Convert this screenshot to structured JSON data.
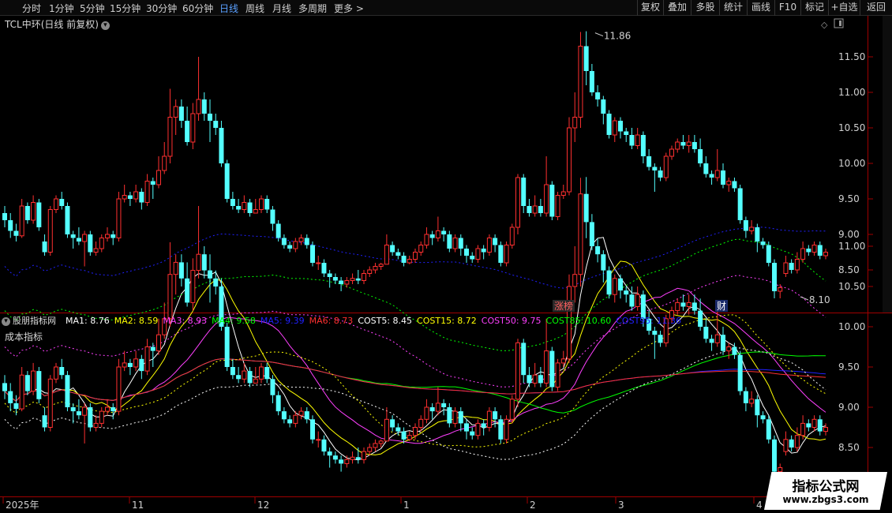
{
  "toolbar": {
    "tabs": [
      "分时",
      "1分钟",
      "5分钟",
      "15分钟",
      "30分钟",
      "60分钟",
      "日线",
      "周线",
      "月线",
      "多周期",
      "更多 >"
    ],
    "active_tab": "日线",
    "right_buttons": [
      "复权",
      "叠加",
      "多股",
      "统计",
      "画线",
      "F10",
      "标记",
      "+自选",
      "返回"
    ]
  },
  "stock": {
    "title": "TCL中环(日线 前复权)",
    "high_label": "11.86",
    "low_label": "8.10",
    "event_zhangbang": "涨榜",
    "event_cai": "财"
  },
  "colors": {
    "up": "#ff3030",
    "down": "#54ffff",
    "ma1": "#ffffff",
    "ma2": "#ffff00",
    "ma3": "#ff40ff",
    "ma4": "#00ff00",
    "ma5": "#2020ff",
    "ma6": "#ff3030",
    "cost5": "#ffffff",
    "cost15": "#ffff00",
    "cost50": "#ff40ff",
    "cost85": "#00ff00",
    "cost95": "#2020ff"
  },
  "price_axis": {
    "ticks": [
      "11.50",
      "11.00",
      "10.50",
      "10.00",
      "9.50",
      "9.00",
      "8.50"
    ]
  },
  "indicator": {
    "name": "股朋指标网",
    "subtitle": "成本指标",
    "items": [
      {
        "key": "ma1",
        "text": "MA1: 8.76"
      },
      {
        "key": "ma2",
        "text": "MA2: 8.59"
      },
      {
        "key": "ma3",
        "text": "MA3: 8.93"
      },
      {
        "key": "ma4",
        "text": "MA4: 9.58"
      },
      {
        "key": "ma5",
        "text": "MA5: 9.39"
      },
      {
        "key": "ma6",
        "text": "MA6: 8.73"
      },
      {
        "key": "cost5",
        "text": "COST5: 8.45"
      },
      {
        "key": "cost15",
        "text": "COST15: 8.72"
      },
      {
        "key": "cost50",
        "text": "COST50: 9.75"
      },
      {
        "key": "cost85",
        "text": "COST85: 10.60"
      },
      {
        "key": "cost95",
        "text": "COST95: 11.36"
      }
    ],
    "ticks": [
      "11.00",
      "10.50",
      "10.00",
      "9.50",
      "9.00",
      "8.50"
    ]
  },
  "date_axis": {
    "labels": [
      "2025年",
      "11",
      "12",
      "1",
      "2",
      "3",
      "4"
    ]
  },
  "watermark": {
    "line1": "指标公式网",
    "line2": "www.zbgs3.com"
  },
  "chart_data": {
    "type": "candlestick",
    "title": "TCL中环(日线 前复权)",
    "y_axis_ticks": [
      8.5,
      9.0,
      9.5,
      10.0,
      10.5,
      11.0,
      11.5
    ],
    "ylim": [
      8.0,
      12.0
    ],
    "x_axis_labels": [
      "2025年",
      "11",
      "12",
      "1",
      "2",
      "3",
      "4"
    ],
    "annotations": [
      {
        "text": "11.86",
        "kind": "high"
      },
      {
        "text": "8.10",
        "kind": "low"
      }
    ],
    "candles": [
      [
        9.3,
        9.2,
        9.4,
        9.1
      ],
      [
        9.2,
        9.05,
        9.3,
        8.95
      ],
      [
        9.05,
        8.98,
        9.15,
        8.9
      ],
      [
        8.98,
        9.4,
        9.5,
        8.95
      ],
      [
        9.4,
        9.2,
        9.45,
        9.15
      ],
      [
        9.2,
        9.45,
        9.55,
        9.15
      ],
      [
        9.45,
        9.1,
        9.5,
        9.05
      ],
      [
        8.9,
        8.75,
        9.0,
        8.7
      ],
      [
        8.75,
        9.35,
        9.4,
        8.7
      ],
      [
        9.35,
        9.5,
        9.55,
        9.3
      ],
      [
        9.5,
        9.4,
        9.6,
        9.35
      ],
      [
        9.4,
        9.0,
        9.45,
        8.95
      ],
      [
        9.0,
        8.95,
        9.05,
        8.8
      ],
      [
        8.95,
        8.9,
        9.1,
        8.85
      ],
      [
        8.9,
        9.0,
        9.05,
        8.55
      ],
      [
        9.0,
        8.75,
        9.05,
        8.7
      ],
      [
        8.75,
        8.8,
        8.9,
        8.7
      ],
      [
        8.8,
        8.95,
        9.0,
        8.75
      ],
      [
        8.95,
        9.0,
        9.1,
        8.9
      ],
      [
        9.0,
        8.95,
        9.05,
        8.85
      ],
      [
        8.95,
        9.5,
        9.6,
        8.9
      ],
      [
        9.5,
        9.55,
        9.7,
        9.45
      ],
      [
        9.55,
        9.5,
        9.6,
        9.4
      ],
      [
        9.5,
        9.6,
        9.7,
        9.45
      ],
      [
        9.6,
        9.45,
        9.65,
        9.35
      ],
      [
        9.45,
        9.75,
        9.85,
        9.4
      ],
      [
        9.75,
        9.7,
        9.8,
        9.5
      ],
      [
        9.7,
        9.9,
        10.1,
        9.65
      ],
      [
        9.9,
        10.1,
        10.3,
        9.85
      ],
      [
        10.1,
        10.65,
        11.05,
        10.0
      ],
      [
        10.65,
        10.8,
        10.9,
        10.4
      ],
      [
        10.8,
        10.6,
        10.9,
        10.5
      ],
      [
        10.6,
        10.3,
        10.8,
        10.25
      ],
      [
        10.3,
        10.7,
        10.85,
        10.2
      ],
      [
        10.7,
        10.9,
        11.5,
        10.6
      ],
      [
        10.9,
        10.7,
        11.0,
        10.6
      ],
      [
        10.7,
        10.6,
        10.9,
        10.3
      ],
      [
        10.6,
        10.5,
        10.7,
        10.4
      ],
      [
        10.5,
        10.0,
        10.6,
        9.95
      ],
      [
        10.0,
        9.5,
        10.05,
        9.45
      ],
      [
        9.5,
        9.4,
        9.6,
        9.35
      ],
      [
        9.4,
        9.35,
        9.5,
        9.3
      ],
      [
        9.35,
        9.45,
        9.55,
        9.3
      ],
      [
        9.45,
        9.3,
        9.5,
        9.25
      ],
      [
        9.3,
        9.35,
        9.5,
        9.3
      ],
      [
        9.35,
        9.5,
        9.55,
        9.3
      ],
      [
        9.5,
        9.35,
        9.55,
        9.3
      ],
      [
        9.35,
        9.15,
        9.4,
        9.05
      ],
      [
        9.15,
        8.95,
        9.2,
        8.9
      ],
      [
        8.95,
        8.85,
        9.0,
        8.8
      ],
      [
        8.85,
        8.8,
        8.9,
        8.75
      ],
      [
        8.8,
        8.9,
        8.95,
        8.75
      ],
      [
        8.9,
        8.95,
        9.0,
        8.85
      ],
      [
        8.95,
        8.85,
        9.0,
        8.8
      ],
      [
        8.85,
        8.6,
        8.9,
        8.55
      ],
      [
        8.6,
        8.6,
        8.7,
        8.5
      ],
      [
        8.6,
        8.45,
        8.65,
        8.4
      ],
      [
        8.45,
        8.4,
        8.5,
        8.25
      ],
      [
        8.4,
        8.35,
        8.45,
        8.3
      ],
      [
        8.35,
        8.3,
        8.4,
        8.2
      ],
      [
        8.3,
        8.35,
        8.4,
        8.25
      ],
      [
        8.35,
        8.38,
        8.45,
        8.3
      ],
      [
        8.38,
        8.35,
        8.5,
        8.3
      ],
      [
        8.35,
        8.45,
        8.5,
        8.3
      ],
      [
        8.45,
        8.5,
        8.55,
        8.4
      ],
      [
        8.5,
        8.55,
        8.6,
        8.45
      ],
      [
        8.55,
        8.58,
        8.6,
        8.5
      ],
      [
        8.58,
        8.85,
        9.0,
        8.75
      ],
      [
        8.85,
        8.75,
        8.9,
        8.7
      ],
      [
        8.75,
        8.7,
        8.8,
        8.65
      ],
      [
        8.7,
        8.6,
        8.75,
        8.55
      ],
      [
        8.6,
        8.65,
        8.7,
        8.58
      ],
      [
        8.65,
        8.75,
        8.8,
        8.6
      ],
      [
        8.75,
        8.85,
        8.9,
        8.7
      ],
      [
        8.85,
        9.0,
        9.1,
        8.8
      ],
      [
        9.0,
        8.95,
        9.05,
        8.85
      ],
      [
        8.95,
        9.05,
        9.25,
        8.9
      ],
      [
        9.05,
        9.0,
        9.1,
        8.9
      ],
      [
        9.0,
        8.8,
        9.05,
        8.75
      ],
      [
        8.8,
        8.95,
        9.0,
        8.75
      ],
      [
        8.95,
        8.8,
        9.0,
        8.7
      ],
      [
        8.8,
        8.7,
        8.85,
        8.6
      ],
      [
        8.7,
        8.65,
        8.75,
        8.6
      ],
      [
        8.65,
        8.8,
        8.85,
        8.6
      ],
      [
        8.8,
        8.75,
        8.85,
        8.65
      ],
      [
        8.75,
        8.95,
        9.0,
        8.7
      ],
      [
        8.95,
        8.85,
        9.0,
        8.75
      ],
      [
        8.85,
        8.6,
        8.9,
        8.55
      ],
      [
        8.6,
        8.85,
        8.9,
        8.55
      ],
      [
        8.85,
        9.1,
        9.15,
        8.8
      ],
      [
        9.1,
        9.8,
        9.85,
        9.0
      ],
      [
        9.8,
        9.4,
        9.85,
        9.3
      ],
      [
        9.4,
        9.3,
        9.5,
        9.25
      ],
      [
        9.3,
        9.4,
        9.55,
        9.25
      ],
      [
        9.4,
        9.3,
        9.5,
        9.25
      ],
      [
        9.3,
        9.7,
        10.1,
        9.25
      ],
      [
        9.7,
        9.25,
        9.75,
        9.2
      ],
      [
        9.25,
        9.55,
        9.6,
        9.2
      ],
      [
        9.55,
        9.6,
        9.7,
        9.5
      ],
      [
        9.6,
        10.5,
        10.65,
        9.55
      ],
      [
        10.5,
        10.65,
        11.0,
        10.3
      ],
      [
        10.65,
        11.65,
        11.85,
        10.5
      ],
      [
        11.65,
        11.3,
        11.86,
        11.1
      ],
      [
        11.3,
        11.0,
        11.4,
        10.95
      ],
      [
        11.0,
        10.9,
        11.1,
        10.8
      ],
      [
        10.9,
        10.7,
        10.95,
        10.55
      ],
      [
        10.7,
        10.4,
        10.75,
        10.35
      ],
      [
        10.4,
        10.6,
        10.65,
        10.3
      ],
      [
        10.6,
        10.45,
        10.65,
        10.35
      ],
      [
        10.45,
        10.4,
        10.5,
        10.3
      ],
      [
        10.4,
        10.25,
        10.5,
        10.2
      ],
      [
        10.25,
        10.4,
        10.5,
        10.2
      ],
      [
        10.4,
        10.1,
        10.45,
        10.0
      ],
      [
        10.1,
        9.95,
        10.2,
        9.9
      ],
      [
        9.95,
        9.9,
        10.0,
        9.6
      ],
      [
        9.9,
        9.8,
        9.95,
        9.75
      ],
      [
        9.8,
        10.1,
        10.15,
        9.75
      ],
      [
        10.1,
        10.2,
        10.25,
        10.05
      ],
      [
        10.2,
        10.3,
        10.35,
        10.15
      ],
      [
        10.3,
        10.25,
        10.4,
        10.2
      ],
      [
        10.25,
        10.3,
        10.4,
        10.15
      ],
      [
        10.3,
        10.2,
        10.4,
        10.15
      ],
      [
        10.2,
        10.0,
        10.35,
        9.95
      ],
      [
        10.0,
        9.85,
        10.1,
        9.8
      ],
      [
        9.85,
        9.8,
        9.9,
        9.7
      ],
      [
        9.8,
        9.9,
        10.2,
        9.75
      ],
      [
        9.9,
        9.7,
        10.0,
        9.65
      ],
      [
        9.7,
        9.75,
        9.8,
        9.6
      ],
      [
        9.75,
        9.65,
        9.8,
        9.6
      ],
      [
        9.65,
        9.2,
        9.7,
        9.15
      ],
      [
        9.2,
        9.05,
        9.25,
        8.95
      ],
      [
        9.05,
        9.1,
        9.2,
        9.0
      ],
      [
        9.1,
        8.9,
        9.15,
        8.75
      ],
      [
        8.9,
        8.85,
        8.95,
        8.8
      ],
      [
        8.85,
        8.6,
        8.9,
        8.55
      ],
      [
        8.6,
        8.2,
        8.65,
        8.1
      ],
      [
        8.2,
        8.25,
        8.3,
        8.1
      ],
      [
        8.45,
        8.6,
        8.7,
        8.4
      ],
      [
        8.6,
        8.5,
        8.65,
        8.45
      ],
      [
        8.5,
        8.65,
        8.75,
        8.45
      ],
      [
        8.65,
        8.8,
        8.9,
        8.6
      ],
      [
        8.8,
        8.75,
        8.85,
        8.7
      ],
      [
        8.75,
        8.85,
        8.9,
        8.7
      ],
      [
        8.85,
        8.7,
        8.9,
        8.65
      ],
      [
        8.7,
        8.75,
        8.8,
        8.65
      ]
    ]
  }
}
